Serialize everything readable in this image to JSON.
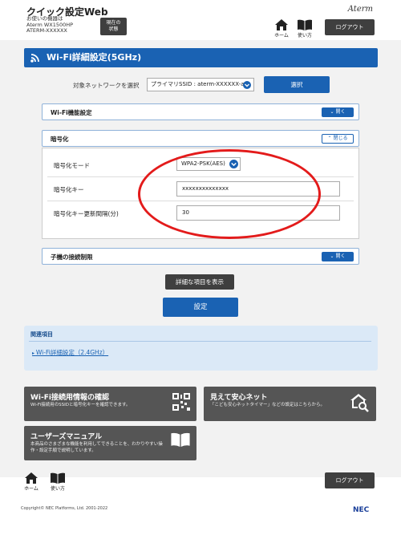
{
  "header": {
    "title": "クイック設定Web",
    "device_line1": "お使いの機器は",
    "device_line2": "Aterm WX1500HP",
    "device_line3": "ATERM-XXXXXX",
    "status_btn_line1": "現在の",
    "status_btn_line2": "状態",
    "brand": "Aterm",
    "home_label": "ホーム",
    "manual_label": "使い方",
    "logout_label": "ログアウト"
  },
  "page": {
    "title": "Wi-Fi詳細設定(5GHz)",
    "network_label": "対象ネットワークを選択",
    "network_value": "プライマリSSID : aterm-XXXXXX-a",
    "select_button": "選択"
  },
  "sections": {
    "wifi_function": {
      "title": "Wi-Fi機能設定",
      "toggle": "開く"
    },
    "encryption": {
      "title": "暗号化",
      "toggle": "閉じる"
    },
    "client_restriction": {
      "title": "子機の接続制限",
      "toggle": "開く"
    }
  },
  "encryption": {
    "mode_label": "暗号化モード",
    "mode_value": "WPA2-PSK(AES)",
    "key_label": "暗号化キー",
    "key_value": "xxxxxxxxxxxxxx",
    "interval_label": "暗号化キー更新間隔(分)",
    "interval_value": "30"
  },
  "buttons": {
    "show_advanced": "詳細な項目を表示",
    "apply": "設定"
  },
  "related": {
    "header": "関連項目",
    "link": "Wi-Fi詳細設定（2.4GHz）"
  },
  "cards": {
    "wifi_info": {
      "title": "Wi-Fi接続用情報の確認",
      "desc": "Wi-Fi接続用のSSIDと暗号化キーを確認できます。"
    },
    "safety_net": {
      "title": "見えて安心ネット",
      "desc": "「こども安心ネットタイマー」などの設定はこちらから。"
    },
    "user_manual": {
      "title": "ユーザーズマニュアル",
      "desc": "本商品のさまざまな機能を利用してできることを、わかりやすい操作・設定手順で説明しています。"
    }
  },
  "footer": {
    "copyright": "Copyright© NEC Platforms, Ltd. 2001-2022",
    "logo": "NEC"
  },
  "colors": {
    "primary_blue": "#1a62b3",
    "dark_button": "#3f3f3f",
    "highlight_red": "#e31b1b"
  }
}
